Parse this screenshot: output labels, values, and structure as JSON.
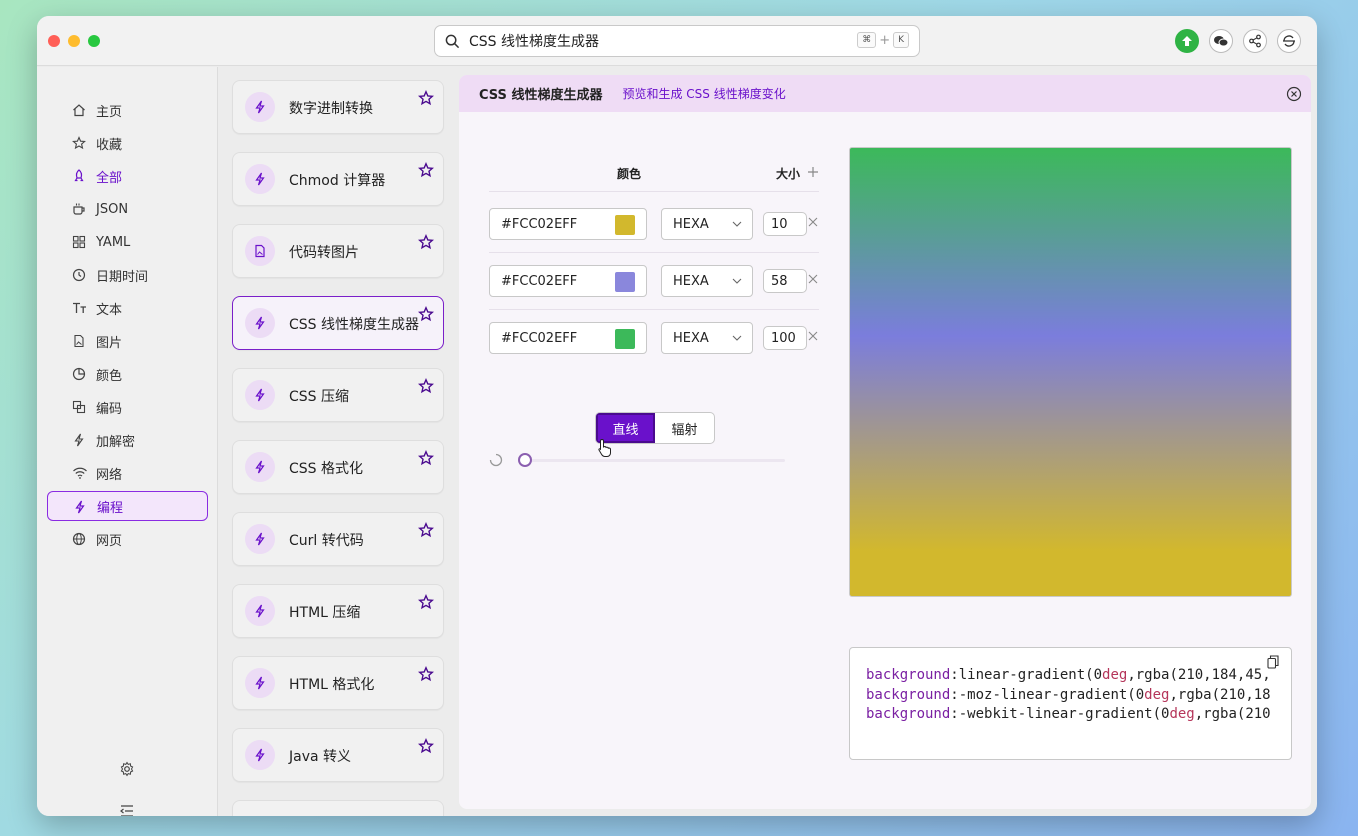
{
  "search": {
    "query": "CSS 线性梯度生成器",
    "shortcut_cmd": "⌘",
    "shortcut_plus": "+",
    "shortcut_key": "K"
  },
  "sidebar": {
    "items": [
      {
        "label": "主页",
        "icon": "home-icon"
      },
      {
        "label": "收藏",
        "icon": "star-icon"
      },
      {
        "label": "全部",
        "icon": "rocket-icon"
      },
      {
        "label": "JSON",
        "icon": "cup-icon"
      },
      {
        "label": "YAML",
        "icon": "grid-icon"
      },
      {
        "label": "日期时间",
        "icon": "clock-icon"
      },
      {
        "label": "文本",
        "icon": "text-icon"
      },
      {
        "label": "图片",
        "icon": "image-file-icon"
      },
      {
        "label": "颜色",
        "icon": "pie-icon"
      },
      {
        "label": "编码",
        "icon": "copy-icon"
      },
      {
        "label": "加解密",
        "icon": "bolt-icon"
      },
      {
        "label": "网络",
        "icon": "wifi-icon"
      },
      {
        "label": "编程",
        "icon": "bolt-icon"
      },
      {
        "label": "网页",
        "icon": "globe-icon"
      }
    ]
  },
  "tools": [
    {
      "label": "数字进制转换"
    },
    {
      "label": "Chmod 计算器"
    },
    {
      "label": "代码转图片"
    },
    {
      "label": "CSS 线性梯度生成器"
    },
    {
      "label": "CSS 压缩"
    },
    {
      "label": "CSS 格式化"
    },
    {
      "label": "Curl 转代码"
    },
    {
      "label": "HTML 压缩"
    },
    {
      "label": "HTML 格式化"
    },
    {
      "label": "Java 转义"
    }
  ],
  "main": {
    "title": "CSS 线性梯度生成器",
    "subtitle": "预览和生成 CSS 线性梯度变化",
    "col_color": "颜色",
    "col_size": "大小",
    "stops": [
      {
        "hex": "#FCC02EFF",
        "swatch": "#d2b82d",
        "format": "HEXA",
        "size": "10"
      },
      {
        "hex": "#FCC02EFF",
        "swatch": "#8a87dc",
        "format": "HEXA",
        "size": "58"
      },
      {
        "hex": "#FCC02EFF",
        "swatch": "#3cb95a",
        "format": "HEXA",
        "size": "100"
      }
    ],
    "mode_linear": "直线",
    "mode_radial": "辐射",
    "angle": 0,
    "code": {
      "line1_prop": "background",
      "line1_rest1": ":linear-gradient(",
      "line1_num": "0",
      "line1_kw": "deg",
      "line1_rest2": ",rgba(210,184,45,",
      "line2_prop": "background",
      "line2_rest1": ":-moz-linear-gradient(",
      "line2_num": "0",
      "line2_kw": "deg",
      "line2_rest2": ",rgba(210,18",
      "line3_prop": "background",
      "line3_rest1": ":-webkit-linear-gradient(",
      "line3_num": "0",
      "line3_kw": "deg",
      "line3_rest2": ",rgba(210"
    }
  },
  "colors": {
    "accent": "#6a11cb",
    "gradient_top": "#3cb95a",
    "gradient_mid": "#7b7ddc",
    "gradient_bottom": "#d2b82d"
  }
}
